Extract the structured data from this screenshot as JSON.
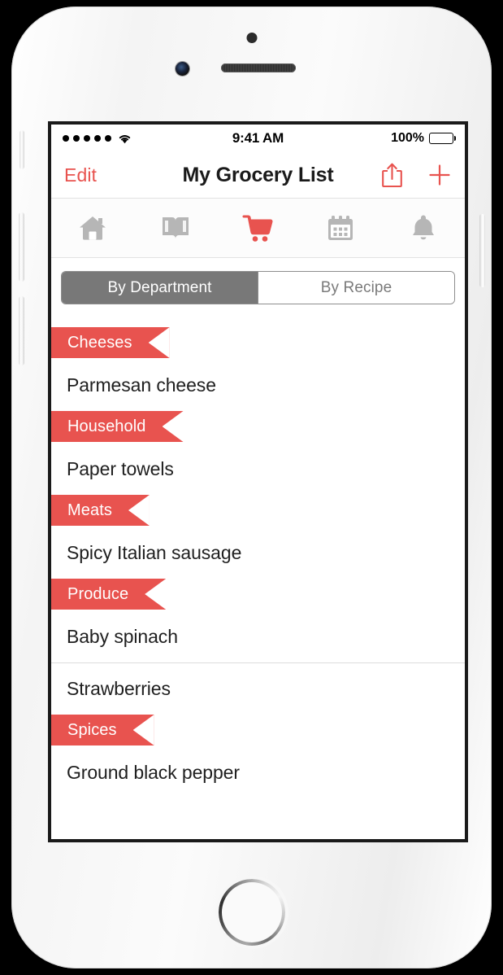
{
  "device": {
    "name": "iphone-white",
    "hardware": {
      "front_camera": "front-camera",
      "earpiece": "earpiece-speaker",
      "sensor": "proximity-sensor",
      "home_button": "home-button",
      "silent_switch": "silent-switch",
      "volume_up": "volume-up-button",
      "volume_down": "volume-down-button",
      "power": "power-button"
    }
  },
  "status_bar": {
    "signal_dots": 5,
    "wifi": "wifi-icon",
    "time": "9:41 AM",
    "battery_percent": "100%",
    "battery_level": 100
  },
  "nav_bar": {
    "edit_label": "Edit",
    "title": "My Grocery List",
    "share_icon": "share-icon",
    "add_icon": "plus-icon",
    "tint_color": "#E8534F"
  },
  "tab_bar": {
    "active_index": 2,
    "active_color": "#E8534F",
    "inactive_color": "#b6b6b6",
    "items": [
      {
        "icon": "home-icon",
        "name": "home"
      },
      {
        "icon": "book-icon",
        "name": "recipes"
      },
      {
        "icon": "cart-icon",
        "name": "grocery-list"
      },
      {
        "icon": "calendar-icon",
        "name": "meal-plan"
      },
      {
        "icon": "bell-icon",
        "name": "reminders"
      }
    ]
  },
  "segmented_control": {
    "selected_index": 0,
    "options": [
      {
        "label": "By Department"
      },
      {
        "label": "By Recipe"
      }
    ]
  },
  "grocery_list": {
    "sections": [
      {
        "title": "Cheeses",
        "items": [
          {
            "name": "Parmesan cheese"
          }
        ]
      },
      {
        "title": "Household",
        "items": [
          {
            "name": "Paper towels"
          }
        ]
      },
      {
        "title": "Meats",
        "items": [
          {
            "name": "Spicy Italian sausage"
          }
        ]
      },
      {
        "title": "Produce",
        "items": [
          {
            "name": "Baby spinach"
          },
          {
            "name": "Strawberries"
          }
        ]
      },
      {
        "title": "Spices",
        "items": [
          {
            "name": "Ground black pepper"
          }
        ]
      }
    ],
    "ribbon_color": "#E8534F"
  }
}
